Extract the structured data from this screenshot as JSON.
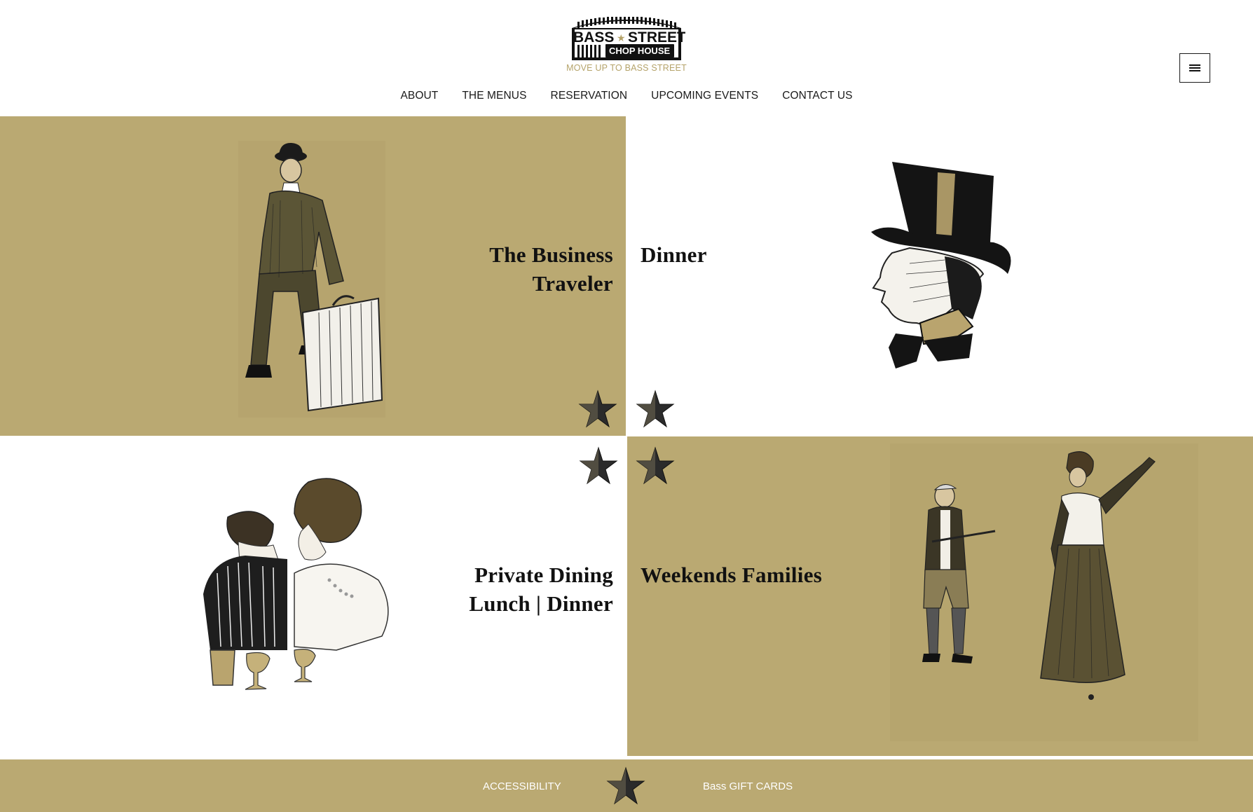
{
  "header": {
    "logo": {
      "line1": "BASS",
      "line1b": "STREET",
      "line2": "CHOP HOUSE",
      "tagline": "MOVE UP TO BASS STREET"
    },
    "nav": [
      {
        "label": "ABOUT"
      },
      {
        "label": "THE MENUS"
      },
      {
        "label": "RESERVATION"
      },
      {
        "label": "UPCOMING EVENTS"
      },
      {
        "label": "CONTACT US"
      }
    ],
    "menu_icon": "hamburger-icon"
  },
  "panels": {
    "business": {
      "line1": "The Business",
      "line2": "Traveler",
      "illustration": "seated-gentleman-with-suitcase"
    },
    "dinner": {
      "line1": "Dinner",
      "illustration": "man-in-top-hat"
    },
    "private": {
      "line1": "Private Dining",
      "line2": "Lunch | Dinner",
      "illustration": "couple-with-drinks"
    },
    "weekends": {
      "line1": "Weekends Families",
      "illustration": "golfer-and-lady"
    }
  },
  "footer": {
    "accessibility": "ACCESSIBILITY",
    "gift_cards": "Bass GIFT CARDS",
    "star_icon": "star-icon"
  },
  "colors": {
    "gold": "#baa972",
    "dark": "#1a1a1a",
    "tagline": "#b5a36a",
    "white": "#ffffff"
  }
}
